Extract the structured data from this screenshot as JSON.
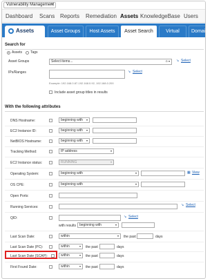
{
  "module": {
    "selected": "Vulnerability Management"
  },
  "nav": {
    "items": [
      "Dashboard",
      "Scans",
      "Reports",
      "Remediation",
      "Assets",
      "KnowledgeBase",
      "Users"
    ],
    "active": "Assets"
  },
  "tabs": {
    "brand": "Assets",
    "items": [
      "Asset Groups",
      "Host Assets",
      "Asset Search",
      "Virtual Hosts",
      "Domains"
    ],
    "active": "Asset Search"
  },
  "search_for": {
    "heading": "Search for",
    "radio_assets": "Assets",
    "radio_tags": "Tags",
    "asset_groups_label": "Asset Groups",
    "asset_groups_placeholder": "Select items...",
    "select_link": "Select",
    "ips_label": "IPs/Ranges",
    "ips_link": "Select",
    "ips_example": "Example: 192.168.0.87-192.168.0.92, 192.168.0.200",
    "include_titles": "Include asset group titles in results"
  },
  "attributes": {
    "heading": "With the following attributes",
    "dns_label": "DNS Hostname:",
    "dns_op": "beginning with",
    "ec2_id_label": "EC2 Instance ID:",
    "ec2_id_op": "beginning with",
    "netbios_label": "NetBIOS Hostname:",
    "netbios_op": "beginning with",
    "tracking_label": "Tracking Method:",
    "tracking_value": "IP address",
    "ec2_status_label": "EC2 Instance status:",
    "ec2_status_value": "RUNNING",
    "os_label": "Operating System:",
    "os_op": "beginning with",
    "os_link": "View",
    "cpe_label": "OS CPE:",
    "cpe_op": "beginning with",
    "ports_label": "Open Ports:",
    "services_label": "Running Services:",
    "services_link": "Select",
    "qid_label": "QID:",
    "qid_link": "Select",
    "qid_with_results": "with results",
    "qid_results_op": "beginning with",
    "last_scan_label": "Last Scan Date:",
    "last_scan_op": "within",
    "last_scan_past": "the past",
    "last_scan_unit": "days",
    "last_scan_pc_label": "Last Scan Date (PC):",
    "last_scan_pc_op": "within",
    "last_scan_pc_past": "the past",
    "last_scan_pc_unit": "days",
    "last_scan_scap_label": "Last Scan Date (SCAP):",
    "last_scan_scap_op": "within",
    "last_scan_scap_past": "the past",
    "last_scan_scap_unit": "days",
    "first_found_label": "First Found Date:",
    "first_found_op": "within",
    "first_found_past": "the past",
    "first_found_unit": "days"
  },
  "colors": {
    "accent": "#2a7ac7",
    "highlight": "#e02020",
    "link": "#1a5fb4"
  }
}
